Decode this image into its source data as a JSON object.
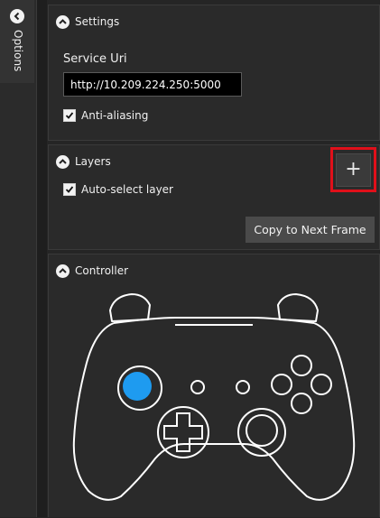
{
  "sidebar": {
    "tab_label": "Options",
    "chevron_icon": "chevron-left-icon"
  },
  "settings": {
    "title": "Settings",
    "service_uri_label": "Service Uri",
    "service_uri_value": "http://10.209.224.250:5000",
    "anti_aliasing_label": "Anti-aliasing",
    "anti_aliasing_checked": true
  },
  "layers": {
    "title": "Layers",
    "auto_select_label": "Auto-select layer",
    "auto_select_checked": true,
    "add_button_label": "+",
    "copy_button_label": "Copy to Next Frame",
    "highlight_color": "#e0101a"
  },
  "controller": {
    "title": "Controller",
    "active_stick": "left-thumbstick",
    "active_color": "#1e9bf0",
    "outline_color": "#ffffff"
  }
}
